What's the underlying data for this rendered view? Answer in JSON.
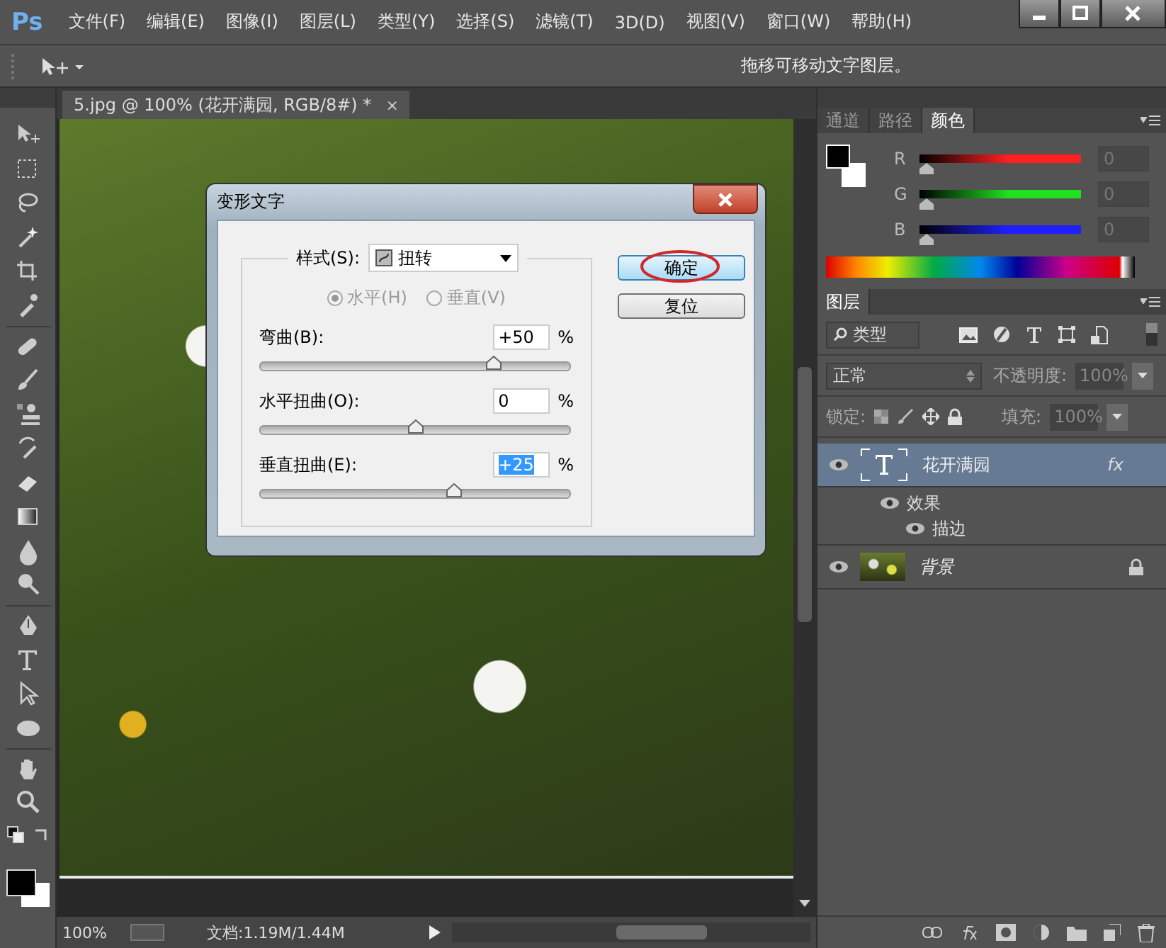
{
  "app": {
    "logo": "Ps"
  },
  "menu": [
    "文件(F)",
    "编辑(E)",
    "图像(I)",
    "图层(L)",
    "类型(Y)",
    "选择(S)",
    "滤镜(T)",
    "3D(D)",
    "视图(V)",
    "窗口(W)",
    "帮助(H)"
  ],
  "options_bar": {
    "hint": "拖移可移动文字图层。"
  },
  "document": {
    "tab": {
      "title": "5.jpg @ 100% (花开满园, RGB/8#) *",
      "close": "×"
    },
    "status": {
      "zoom": "100%",
      "doc_size": "文档:1.19M/1.44M"
    }
  },
  "dialog": {
    "title": "变形文字",
    "style_label": "样式(S):",
    "style_value": "扭转",
    "orientation_disabled": true,
    "orientation": [
      {
        "label": "水平(H)",
        "selected": true
      },
      {
        "label": "垂直(V)",
        "selected": false
      }
    ],
    "sliders": [
      {
        "label": "弯曲(B):",
        "value": "+50",
        "unit": "%",
        "level": 0.75,
        "text_selected": false
      },
      {
        "label": "水平扭曲(O):",
        "value": "0",
        "unit": "%",
        "level": 0.5,
        "text_selected": false
      },
      {
        "label": "垂直扭曲(E):",
        "value": "+25",
        "unit": "%",
        "level": 0.625,
        "text_selected": true
      }
    ],
    "buttons": [
      {
        "label": "确定",
        "default": true,
        "circled": true
      },
      {
        "label": "复位",
        "default": false,
        "circled": false
      }
    ]
  },
  "color_panel": {
    "tabs": [
      {
        "label": "通道",
        "selected": false
      },
      {
        "label": "路径",
        "selected": false
      },
      {
        "label": "颜色",
        "selected": true
      }
    ],
    "channels": [
      {
        "label": "R",
        "value": "0",
        "level": 0,
        "color": "#ff2020"
      },
      {
        "label": "G",
        "value": "0",
        "level": 0,
        "color": "#20e020"
      },
      {
        "label": "B",
        "value": "0",
        "level": 0,
        "color": "#2020ff"
      }
    ]
  },
  "layers_panel": {
    "tab": "图层",
    "filter": "类型",
    "blend_mode": "正常",
    "opacity_label": "不透明度:",
    "opacity": "100%",
    "lock_label": "锁定:",
    "fill_label": "填充:",
    "fill": "100%",
    "layers": [
      {
        "name": "花开满园",
        "kind": "text",
        "selected": true,
        "visible": true,
        "locked": false,
        "fx": "fx",
        "children": [
          {
            "name": "效果",
            "visible": true,
            "children": [
              {
                "name": "描边",
                "visible": true
              }
            ]
          }
        ]
      },
      {
        "name": "背景",
        "kind": "image",
        "selected": false,
        "visible": true,
        "locked": true
      }
    ]
  }
}
